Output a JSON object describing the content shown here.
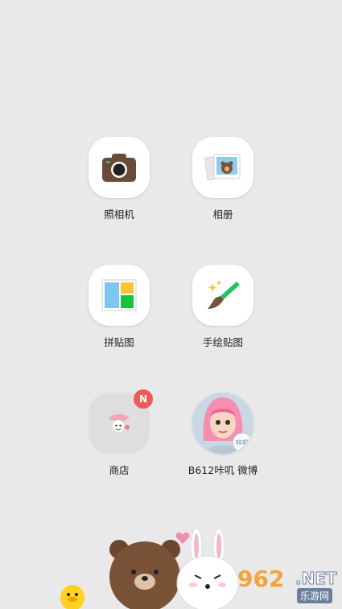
{
  "apps": [
    {
      "label": "照相机",
      "icon": "camera-icon"
    },
    {
      "label": "相册",
      "icon": "album-icon"
    },
    {
      "label": "拼贴图",
      "icon": "collage-icon"
    },
    {
      "label": "手绘贴图",
      "icon": "paint-brush-icon"
    },
    {
      "label": "商店",
      "icon": "store-icon",
      "badge": "N"
    },
    {
      "label": "B612咔叽 微博",
      "icon": "avatar-icon",
      "avatar_tag": "咔叽"
    }
  ],
  "watermark": {
    "number": "962",
    "suffix": ".NET",
    "site": "乐游网"
  },
  "colors": {
    "background": "#e9e9e9",
    "badge": "#f05a5a",
    "camera_body": "#6b4a3a",
    "brush_green": "#22c55e",
    "collage_blue": "#7cc7f2",
    "collage_yellow": "#f7c531",
    "collage_green": "#16c23a"
  }
}
